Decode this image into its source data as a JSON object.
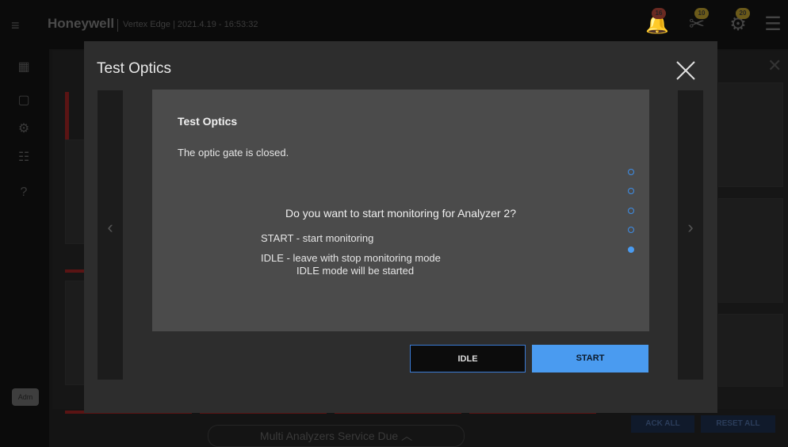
{
  "header": {
    "brand": "Honeywell",
    "subtitle": "Vertex Edge | 2021.4.19 - 16:53:32",
    "icons": [
      {
        "name": "bell-icon",
        "badge": "16",
        "badge_color": "#e8513c"
      },
      {
        "name": "tools-icon",
        "badge": "10",
        "badge_color": "#d9b526"
      },
      {
        "name": "maintenance-icon",
        "badge": "20",
        "badge_color": "#d9b526"
      },
      {
        "name": "analyzer-list-icon",
        "badge": "",
        "badge_color": "#bbbbbb"
      }
    ]
  },
  "sidebar": {
    "items": [
      "dashboard-icon",
      "report-icon",
      "settings-icon",
      "config-icon",
      "help-icon"
    ],
    "avatar": "Adm"
  },
  "background": {
    "service_due": "Multi Analyzers Service Due ︿",
    "ack_all": "ACK ALL",
    "reset_all": "RESET ALL"
  },
  "modal": {
    "title": "Test Optics",
    "content_title": "Test Optics",
    "message": "The optic gate is closed.",
    "question": "Do you want to start monitoring for Analyzer 2?",
    "option_start": "START - start monitoring",
    "option_idle": "IDLE - leave with stop monitoring mode",
    "option_idle_sub": "IDLE mode will be started",
    "step_count": 5,
    "active_step": 5,
    "idle_label": "IDLE",
    "start_label": "START"
  },
  "colors": {
    "accent": "#4a9bf0",
    "modal_bg": "#2d2d2d",
    "content_bg": "#4b4b4b"
  }
}
